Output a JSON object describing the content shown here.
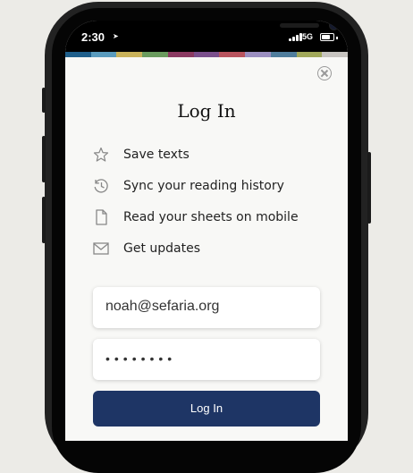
{
  "status_bar": {
    "time": "2:30",
    "network": "5G",
    "location_icon": "location-arrow-icon",
    "signal_icon": "signal-bars-icon",
    "battery_icon": "battery-icon",
    "battery_level": 0.75
  },
  "color_band": [
    "#1f5f8b",
    "#5a9bbd",
    "#c9b25a",
    "#6a9b5e",
    "#8b3a62",
    "#7a4f8c",
    "#b8545e",
    "#9b8fc0",
    "#4f7d9c",
    "#a1a85a",
    "#c7c4c0"
  ],
  "close_button": {
    "icon": "close-circle-icon"
  },
  "title": "Log In",
  "features": [
    {
      "icon": "star-icon",
      "label": "Save texts"
    },
    {
      "icon": "history-clock-icon",
      "label": "Sync your reading history"
    },
    {
      "icon": "document-icon",
      "label": "Read your sheets on mobile"
    },
    {
      "icon": "envelope-icon",
      "label": "Get updates"
    }
  ],
  "form": {
    "email_value": "noah@sefaria.org",
    "password_value": "••••••••",
    "submit_label": "Log In"
  },
  "colors": {
    "accent": "#1e3565",
    "background": "#f8f8f6",
    "page_background": "#ecebe7"
  }
}
